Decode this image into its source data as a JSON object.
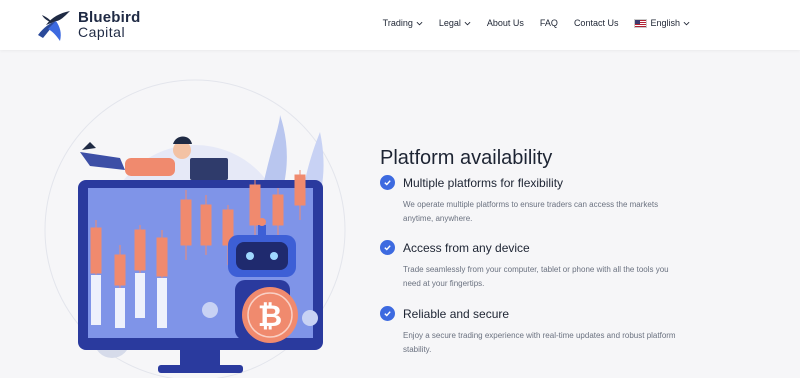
{
  "brand": {
    "name_line1": "Bluebird",
    "name_line2": "Capital"
  },
  "nav": [
    {
      "label": "Trading",
      "dropdown": true
    },
    {
      "label": "Legal",
      "dropdown": true
    },
    {
      "label": "About Us",
      "dropdown": false
    },
    {
      "label": "FAQ",
      "dropdown": false
    },
    {
      "label": "Contact Us",
      "dropdown": false
    }
  ],
  "language": {
    "label": "English",
    "flag": "us-flag-icon"
  },
  "section": {
    "title": "Platform availability",
    "features": [
      {
        "title": "Multiple platforms for flexibility",
        "desc_line1": "We operate multiple platforms to ensure traders can access the markets",
        "desc_line2": "anytime, anywhere."
      },
      {
        "title": "Access from any device",
        "desc_line1": "Trade seamlessly from your computer, tablet or phone with all the tools you",
        "desc_line2": "need at your fingertips."
      },
      {
        "title": "Reliable and secure",
        "desc_line1": "Enjoy a secure trading experience with real-time updates and robust platform",
        "desc_line2": "stability."
      }
    ]
  },
  "colors": {
    "accent": "#3d6ae0",
    "text_dark": "#1d2433",
    "text_muted": "#6b7280",
    "candle_red": "#f08a6e"
  }
}
